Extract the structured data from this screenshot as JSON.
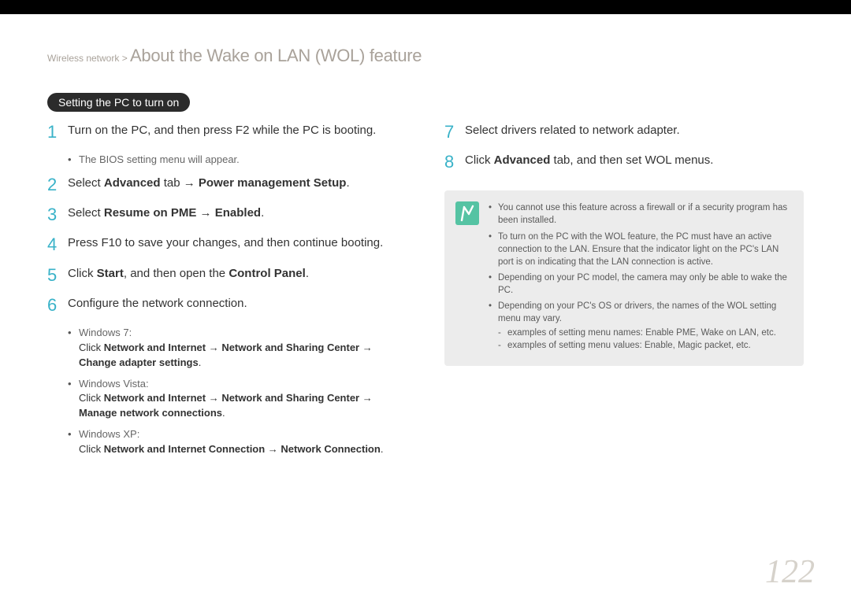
{
  "header": {
    "breadcrumb": "Wireless network > ",
    "title": "About the Wake on LAN (WOL) feature"
  },
  "section_badge": "Setting the PC to turn on",
  "left": {
    "steps": [
      {
        "num": "1",
        "text": "Turn on the PC, and then press F2 while the PC is booting.",
        "sub": [
          {
            "lead": "The BIOS setting menu will appear."
          }
        ]
      },
      {
        "num": "2",
        "html": "Select <strong>Advanced</strong> tab → <strong>Power management Setup</strong>."
      },
      {
        "num": "3",
        "html": "Select <strong>Resume on PME</strong> → <strong>Enabled</strong>."
      },
      {
        "num": "4",
        "text": "Press F10 to save your changes, and then continue booting."
      },
      {
        "num": "5",
        "html": "Click <strong>Start</strong>, and then open the <strong>Control Panel</strong>."
      },
      {
        "num": "6",
        "text": "Configure the network connection.",
        "sub": [
          {
            "lead": "Windows 7:",
            "detail_html": "Click <strong>Network and Internet</strong> → <strong>Network and Sharing Center</strong> → <strong>Change adapter settings</strong>."
          },
          {
            "lead": "Windows Vista:",
            "detail_html": "Click <strong>Network and Internet</strong> → <strong>Network and Sharing Center</strong> → <strong>Manage network connections</strong>."
          },
          {
            "lead": "Windows XP:",
            "detail_html": "Click <strong>Network and Internet Connection</strong> → <strong>Network Connection</strong>."
          }
        ]
      }
    ]
  },
  "right": {
    "steps": [
      {
        "num": "7",
        "text": "Select drivers related to network adapter."
      },
      {
        "num": "8",
        "html": "Click <strong>Advanced</strong> tab, and then set WOL menus."
      }
    ],
    "notes": [
      {
        "text": "You cannot use this feature across a firewall or if a security program has been installed."
      },
      {
        "text": "To turn on the PC with the WOL feature, the PC must have an active connection to the LAN. Ensure that the indicator light on the PC's LAN port is on indicating that the LAN connection is active."
      },
      {
        "text": "Depending on your PC model, the camera may only be able to wake the PC."
      },
      {
        "text": "Depending on your PC's OS or drivers, the names of the WOL setting menu may vary.",
        "sub": [
          "examples of setting menu names: Enable PME, Wake on LAN, etc.",
          "examples of setting menu values: Enable, Magic packet, etc."
        ]
      }
    ]
  },
  "page_number": "122"
}
